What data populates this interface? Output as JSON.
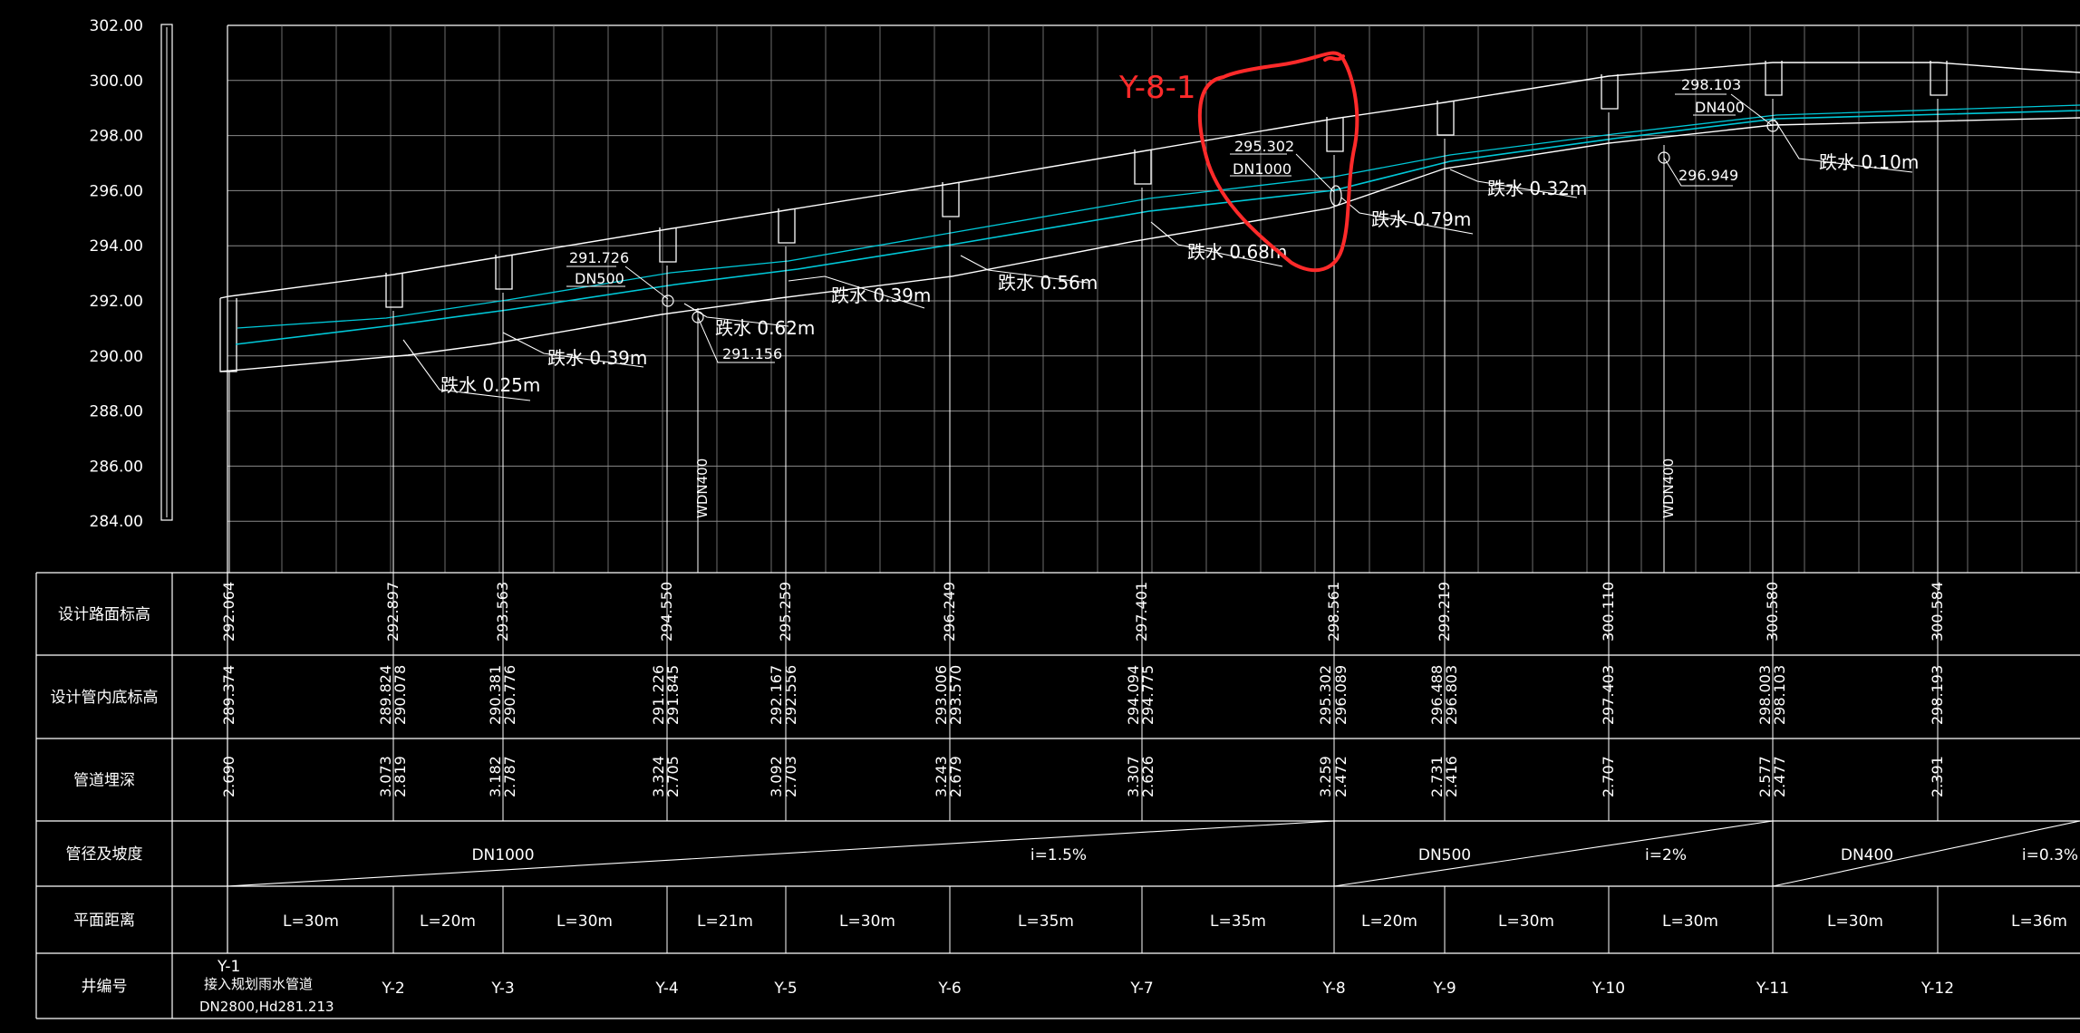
{
  "y_axis": {
    "labels": [
      "302.00",
      "300.00",
      "298.00",
      "296.00",
      "294.00",
      "292.00",
      "290.00",
      "288.00",
      "286.00",
      "284.00"
    ],
    "values": [
      302,
      300,
      298,
      296,
      294,
      292,
      290,
      288,
      286,
      284
    ]
  },
  "table_rows": [
    {
      "key": "road",
      "label": "设计路面标高"
    },
    {
      "key": "invert",
      "label": "设计管内底标高"
    },
    {
      "key": "depth",
      "label": "管道埋深"
    },
    {
      "key": "dia",
      "label": "管径及坡度"
    },
    {
      "key": "dist",
      "label": "平面距离"
    },
    {
      "key": "well",
      "label": "井编号"
    }
  ],
  "road_elevations": [
    "292.064",
    "292.897",
    "293.563",
    "294.550",
    "295.259",
    "296.249",
    "297.401",
    "298.561",
    "299.219",
    "300.110",
    "300.580",
    "300.584"
  ],
  "invert_elevations": [
    "289.374",
    "289.824",
    "290.078",
    "290.381",
    "290.776",
    "291.226",
    "291.845",
    "292.167",
    "292.556",
    "293.006",
    "293.570",
    "294.094",
    "294.775",
    "295.302",
    "296.089",
    "296.488",
    "296.803",
    "297.403",
    "298.003",
    "298.103",
    "298.193"
  ],
  "depths": [
    "2.690",
    "3.073",
    "2.819",
    "3.182",
    "2.787",
    "3.324",
    "2.705",
    "3.092",
    "2.703",
    "3.243",
    "2.679",
    "3.307",
    "2.626",
    "3.259",
    "2.472",
    "2.731",
    "2.416",
    "2.707",
    "2.577",
    "2.477",
    "2.391"
  ],
  "segments": [
    {
      "dn": "DN1000",
      "slope": "i=1.5%"
    },
    {
      "dn": "DN500",
      "slope": "i=2%"
    },
    {
      "dn": "DN400",
      "slope": "i=0.3%"
    }
  ],
  "distances": [
    "L=30m",
    "L=20m",
    "L=30m",
    "L=21m",
    "L=30m",
    "L=35m",
    "L=35m",
    "L=20m",
    "L=30m",
    "L=30m",
    "L=30m",
    "L=36m"
  ],
  "wells": [
    "Y-2",
    "Y-3",
    "Y-4",
    "Y-5",
    "Y-6",
    "Y-7",
    "Y-8",
    "Y-9",
    "Y-10",
    "Y-11",
    "Y-12"
  ],
  "first_well": {
    "id": "Y-1",
    "note1": "接入规划雨水管道",
    "note2": "DN2800,Hd281.213"
  },
  "drops": [
    "跌水 0.25m",
    "跌水 0.39m",
    "跌水 0.62m",
    "跌水 0.39m",
    "跌水 0.56m",
    "跌水 0.68m",
    "跌水 0.79m",
    "跌水 0.32m",
    "跌水 0.10m"
  ],
  "callouts": [
    {
      "value": "291.726",
      "dn": "DN500"
    },
    {
      "value": "291.156"
    },
    {
      "value": "295.302",
      "dn": "DN1000"
    },
    {
      "value": "296.949"
    },
    {
      "value": "298.103",
      "dn": "DN400"
    }
  ],
  "branch_labels": [
    "WDN400",
    "WDN400"
  ],
  "annotation": {
    "label": "Y-8-1",
    "color": "#ff2a2a"
  },
  "colors": {
    "background": "#000000",
    "lines": "#ffffff",
    "pipe": "#00c8d8",
    "grid": "#8a8a8a",
    "markup": "#ff2a2a"
  }
}
